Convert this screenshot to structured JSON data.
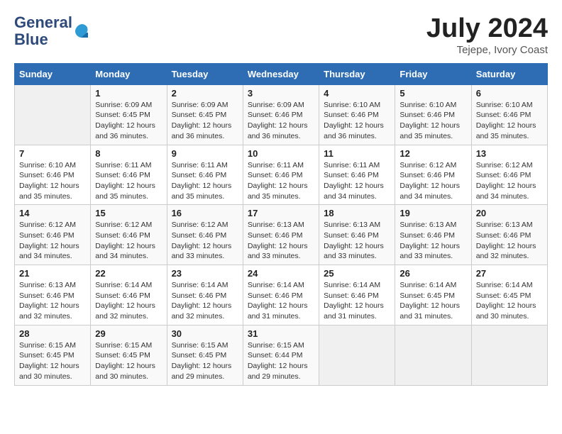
{
  "header": {
    "logo_line1": "General",
    "logo_line2": "Blue",
    "month_title": "July 2024",
    "location": "Tejepe, Ivory Coast"
  },
  "days_of_week": [
    "Sunday",
    "Monday",
    "Tuesday",
    "Wednesday",
    "Thursday",
    "Friday",
    "Saturday"
  ],
  "weeks": [
    [
      {
        "day": "",
        "info": ""
      },
      {
        "day": "1",
        "info": "Sunrise: 6:09 AM\nSunset: 6:45 PM\nDaylight: 12 hours\nand 36 minutes."
      },
      {
        "day": "2",
        "info": "Sunrise: 6:09 AM\nSunset: 6:45 PM\nDaylight: 12 hours\nand 36 minutes."
      },
      {
        "day": "3",
        "info": "Sunrise: 6:09 AM\nSunset: 6:46 PM\nDaylight: 12 hours\nand 36 minutes."
      },
      {
        "day": "4",
        "info": "Sunrise: 6:10 AM\nSunset: 6:46 PM\nDaylight: 12 hours\nand 36 minutes."
      },
      {
        "day": "5",
        "info": "Sunrise: 6:10 AM\nSunset: 6:46 PM\nDaylight: 12 hours\nand 35 minutes."
      },
      {
        "day": "6",
        "info": "Sunrise: 6:10 AM\nSunset: 6:46 PM\nDaylight: 12 hours\nand 35 minutes."
      }
    ],
    [
      {
        "day": "7",
        "info": ""
      },
      {
        "day": "8",
        "info": "Sunrise: 6:11 AM\nSunset: 6:46 PM\nDaylight: 12 hours\nand 35 minutes."
      },
      {
        "day": "9",
        "info": "Sunrise: 6:11 AM\nSunset: 6:46 PM\nDaylight: 12 hours\nand 35 minutes."
      },
      {
        "day": "10",
        "info": "Sunrise: 6:11 AM\nSunset: 6:46 PM\nDaylight: 12 hours\nand 35 minutes."
      },
      {
        "day": "11",
        "info": "Sunrise: 6:11 AM\nSunset: 6:46 PM\nDaylight: 12 hours\nand 34 minutes."
      },
      {
        "day": "12",
        "info": "Sunrise: 6:12 AM\nSunset: 6:46 PM\nDaylight: 12 hours\nand 34 minutes."
      },
      {
        "day": "13",
        "info": "Sunrise: 6:12 AM\nSunset: 6:46 PM\nDaylight: 12 hours\nand 34 minutes."
      }
    ],
    [
      {
        "day": "14",
        "info": ""
      },
      {
        "day": "15",
        "info": "Sunrise: 6:12 AM\nSunset: 6:46 PM\nDaylight: 12 hours\nand 34 minutes."
      },
      {
        "day": "16",
        "info": "Sunrise: 6:12 AM\nSunset: 6:46 PM\nDaylight: 12 hours\nand 33 minutes."
      },
      {
        "day": "17",
        "info": "Sunrise: 6:13 AM\nSunset: 6:46 PM\nDaylight: 12 hours\nand 33 minutes."
      },
      {
        "day": "18",
        "info": "Sunrise: 6:13 AM\nSunset: 6:46 PM\nDaylight: 12 hours\nand 33 minutes."
      },
      {
        "day": "19",
        "info": "Sunrise: 6:13 AM\nSunset: 6:46 PM\nDaylight: 12 hours\nand 33 minutes."
      },
      {
        "day": "20",
        "info": "Sunrise: 6:13 AM\nSunset: 6:46 PM\nDaylight: 12 hours\nand 32 minutes."
      }
    ],
    [
      {
        "day": "21",
        "info": ""
      },
      {
        "day": "22",
        "info": "Sunrise: 6:14 AM\nSunset: 6:46 PM\nDaylight: 12 hours\nand 32 minutes."
      },
      {
        "day": "23",
        "info": "Sunrise: 6:14 AM\nSunset: 6:46 PM\nDaylight: 12 hours\nand 32 minutes."
      },
      {
        "day": "24",
        "info": "Sunrise: 6:14 AM\nSunset: 6:46 PM\nDaylight: 12 hours\nand 31 minutes."
      },
      {
        "day": "25",
        "info": "Sunrise: 6:14 AM\nSunset: 6:46 PM\nDaylight: 12 hours\nand 31 minutes."
      },
      {
        "day": "26",
        "info": "Sunrise: 6:14 AM\nSunset: 6:45 PM\nDaylight: 12 hours\nand 31 minutes."
      },
      {
        "day": "27",
        "info": "Sunrise: 6:14 AM\nSunset: 6:45 PM\nDaylight: 12 hours\nand 30 minutes."
      }
    ],
    [
      {
        "day": "28",
        "info": "Sunrise: 6:15 AM\nSunset: 6:45 PM\nDaylight: 12 hours\nand 30 minutes."
      },
      {
        "day": "29",
        "info": "Sunrise: 6:15 AM\nSunset: 6:45 PM\nDaylight: 12 hours\nand 30 minutes."
      },
      {
        "day": "30",
        "info": "Sunrise: 6:15 AM\nSunset: 6:45 PM\nDaylight: 12 hours\nand 29 minutes."
      },
      {
        "day": "31",
        "info": "Sunrise: 6:15 AM\nSunset: 6:44 PM\nDaylight: 12 hours\nand 29 minutes."
      },
      {
        "day": "",
        "info": ""
      },
      {
        "day": "",
        "info": ""
      },
      {
        "day": "",
        "info": ""
      }
    ]
  ]
}
